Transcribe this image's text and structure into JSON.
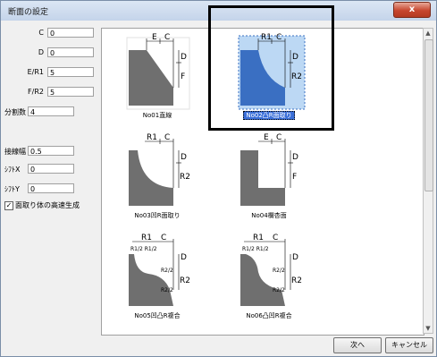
{
  "window": {
    "title": "断面の設定",
    "close_label": "x"
  },
  "fields": [
    {
      "label": "C",
      "value": "0"
    },
    {
      "label": "D",
      "value": "0"
    },
    {
      "label": "E/R1",
      "value": "5"
    },
    {
      "label": "F/R2",
      "value": "5"
    },
    {
      "label": "分割数",
      "value": "4"
    },
    {
      "label": "接線幅",
      "value": "0.5"
    },
    {
      "label": "ｼﾌﾄX",
      "value": "0"
    },
    {
      "label": "ｼﾌﾄY",
      "value": "0"
    }
  ],
  "checkbox": {
    "label": "面取り体の高速生成",
    "checked": true,
    "mark": "✓"
  },
  "tiles": [
    {
      "caption": "No01直線",
      "selected": false,
      "labels": {
        "top1": "E",
        "top2": "C",
        "side1": "D",
        "side2": "F"
      }
    },
    {
      "caption": "No02凸R面取り",
      "selected": true,
      "labels": {
        "top1": "R1",
        "top2": "C",
        "side1": "D",
        "side2": "R2"
      }
    },
    {
      "caption": "No03凹R面取り",
      "selected": false,
      "labels": {
        "top1": "R1",
        "top2": "C",
        "side1": "D",
        "side2": "R2"
      }
    },
    {
      "caption": "No04欄杏面",
      "selected": false,
      "labels": {
        "top1": "E",
        "top2": "C",
        "side1": "D",
        "side2": "F"
      }
    },
    {
      "caption": "No05凹凸R複合",
      "selected": false,
      "labels": {
        "top1": "R1",
        "top2": "C",
        "sub": "R1/2 R1/2",
        "side1": "D",
        "side2": "R2/2",
        "side3": "R2",
        "side4": "R2/2"
      }
    },
    {
      "caption": "No06凸凹R複合",
      "selected": false,
      "labels": {
        "top1": "R1",
        "top2": "C",
        "sub": "R1/2 R1/2",
        "side1": "D",
        "side2": "R2/2",
        "side3": "R2",
        "side4": "R2/2"
      }
    }
  ],
  "buttons": {
    "next": "次へ",
    "cancel": "キャンセル"
  },
  "colors": {
    "profile": "#6f6f6f",
    "selected_bg": "#bcd8f4",
    "selected_profile": "#3a6fc2"
  }
}
